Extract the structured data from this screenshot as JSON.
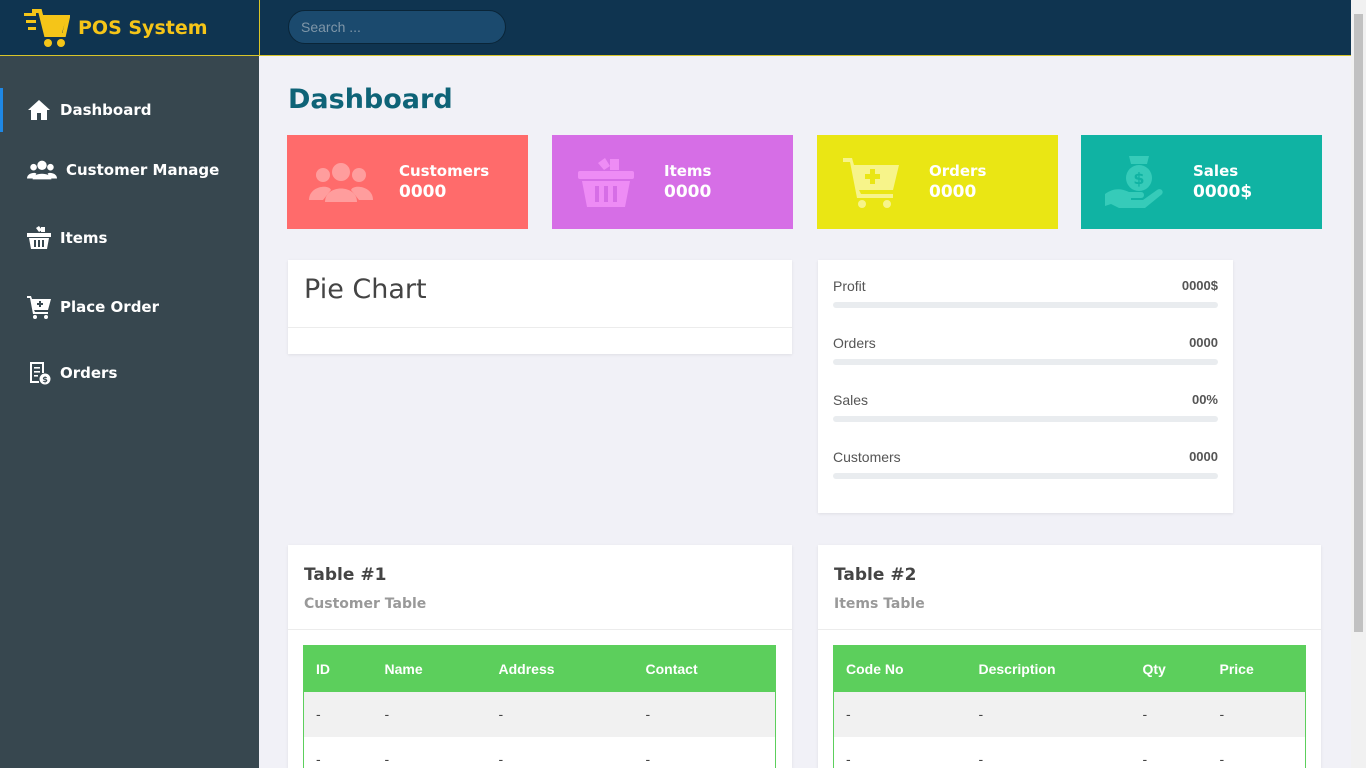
{
  "brand": {
    "title": "POS System"
  },
  "search": {
    "placeholder": "Search ..."
  },
  "sidebar": {
    "items": [
      {
        "label": "Dashboard",
        "icon": "home-icon",
        "active": true
      },
      {
        "label": "Customer Manage",
        "icon": "users-icon"
      },
      {
        "label": "Items",
        "icon": "basket-icon"
      },
      {
        "label": "Place Order",
        "icon": "cart-plus-icon"
      },
      {
        "label": "Orders",
        "icon": "receipt-icon"
      }
    ]
  },
  "page": {
    "title": "Dashboard"
  },
  "stats": [
    {
      "label": "Customers",
      "value": "0000",
      "color": "#ff6b6b",
      "icon": "users-icon"
    },
    {
      "label": "Items",
      "value": "0000",
      "color": "#d66ee6",
      "icon": "basket-icon"
    },
    {
      "label": "Orders",
      "value": "0000",
      "color": "#eae614",
      "icon": "cart-plus-icon"
    },
    {
      "label": "Sales",
      "value": "0000$",
      "color": "#10b3a3",
      "icon": "money-hand-icon"
    }
  ],
  "pie": {
    "title": "Pie Chart"
  },
  "metrics": [
    {
      "label": "Profit",
      "value": "0000$",
      "progress": 0
    },
    {
      "label": "Orders",
      "value": "0000",
      "progress": 0
    },
    {
      "label": "Sales",
      "value": "00%",
      "progress": 0
    },
    {
      "label": "Customers",
      "value": "0000",
      "progress": 0
    }
  ],
  "table1": {
    "title": "Table #1",
    "subtitle": "Customer Table",
    "headers": [
      "ID",
      "Name",
      "Address",
      "Contact"
    ],
    "rows": [
      [
        "-",
        "-",
        "-",
        "-"
      ],
      [
        "-",
        "-",
        "-",
        "-"
      ]
    ]
  },
  "table2": {
    "title": "Table #2",
    "subtitle": "Items Table",
    "headers": [
      "Code No",
      "Description",
      "Qty",
      "Price"
    ],
    "rows": [
      [
        "-",
        "-",
        "-",
        "-"
      ],
      [
        "-",
        "-",
        "-",
        "-"
      ]
    ]
  },
  "colors": {
    "header": "#0f3450",
    "sidebar": "#37474f",
    "accent": "#f5c518",
    "table_head": "#5ccf5c",
    "title": "#0e6377"
  }
}
